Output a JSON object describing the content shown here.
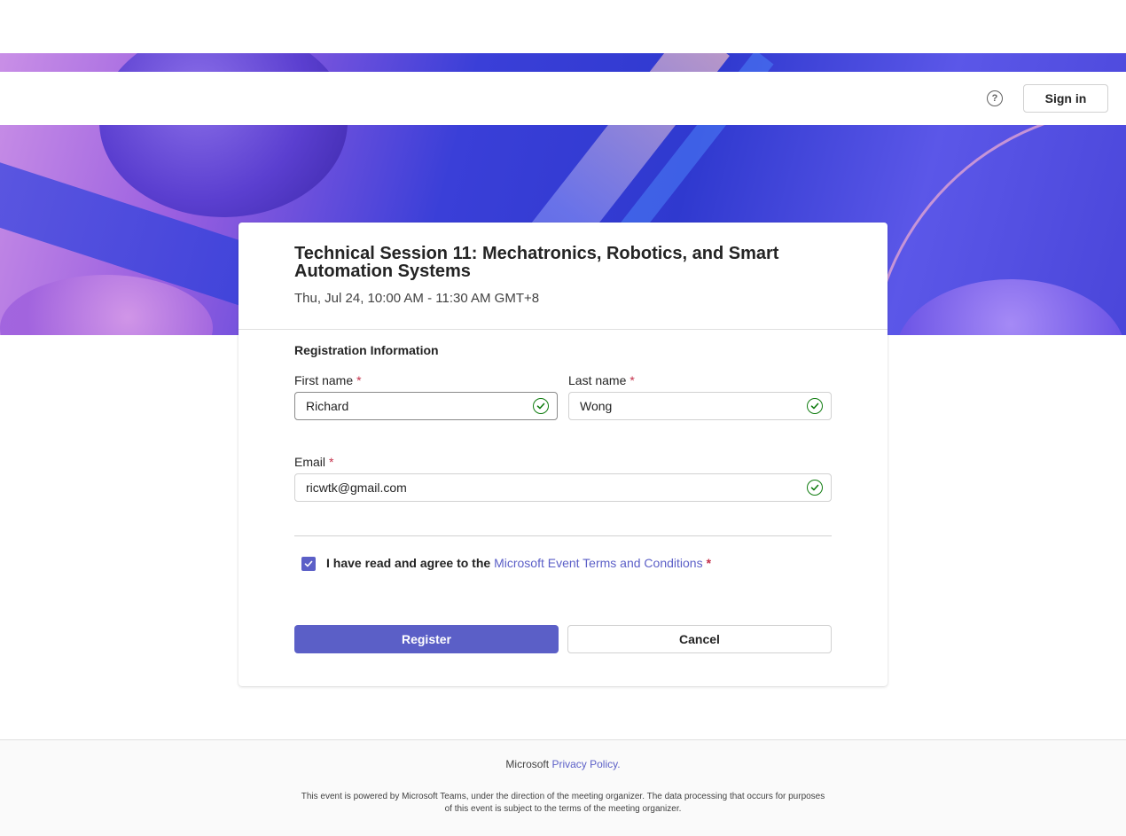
{
  "header": {
    "help_icon": "question-circle-icon",
    "help_glyph": "?",
    "signin_label": "Sign in"
  },
  "event": {
    "title": "Technical Session 11: Mechatronics, Robotics, and Smart Automation Systems",
    "time": "Thu, Jul 24, 10:00 AM - 11:30 AM GMT+8"
  },
  "form": {
    "section_title": "Registration Information",
    "required_marker": "*",
    "first_name": {
      "label": "First name",
      "value": "Richard"
    },
    "last_name": {
      "label": "Last name",
      "value": "Wong"
    },
    "email": {
      "label": "Email",
      "value": "ricwtk@gmail.com"
    },
    "agree": {
      "checked": true,
      "text": "I have read and agree to the",
      "link": "Microsoft Event Terms and Conditions"
    },
    "register_label": "Register",
    "cancel_label": "Cancel"
  },
  "footer": {
    "brand": "Microsoft",
    "privacy": "Privacy Policy.",
    "note": "This event is powered by Microsoft Teams, under the direction of the meeting organizer. The data processing that occurs for purposes of this event is subject to the terms of the meeting organizer."
  },
  "colors": {
    "accent": "#5b5fc7",
    "success": "#107c10",
    "required": "#c4314b"
  }
}
